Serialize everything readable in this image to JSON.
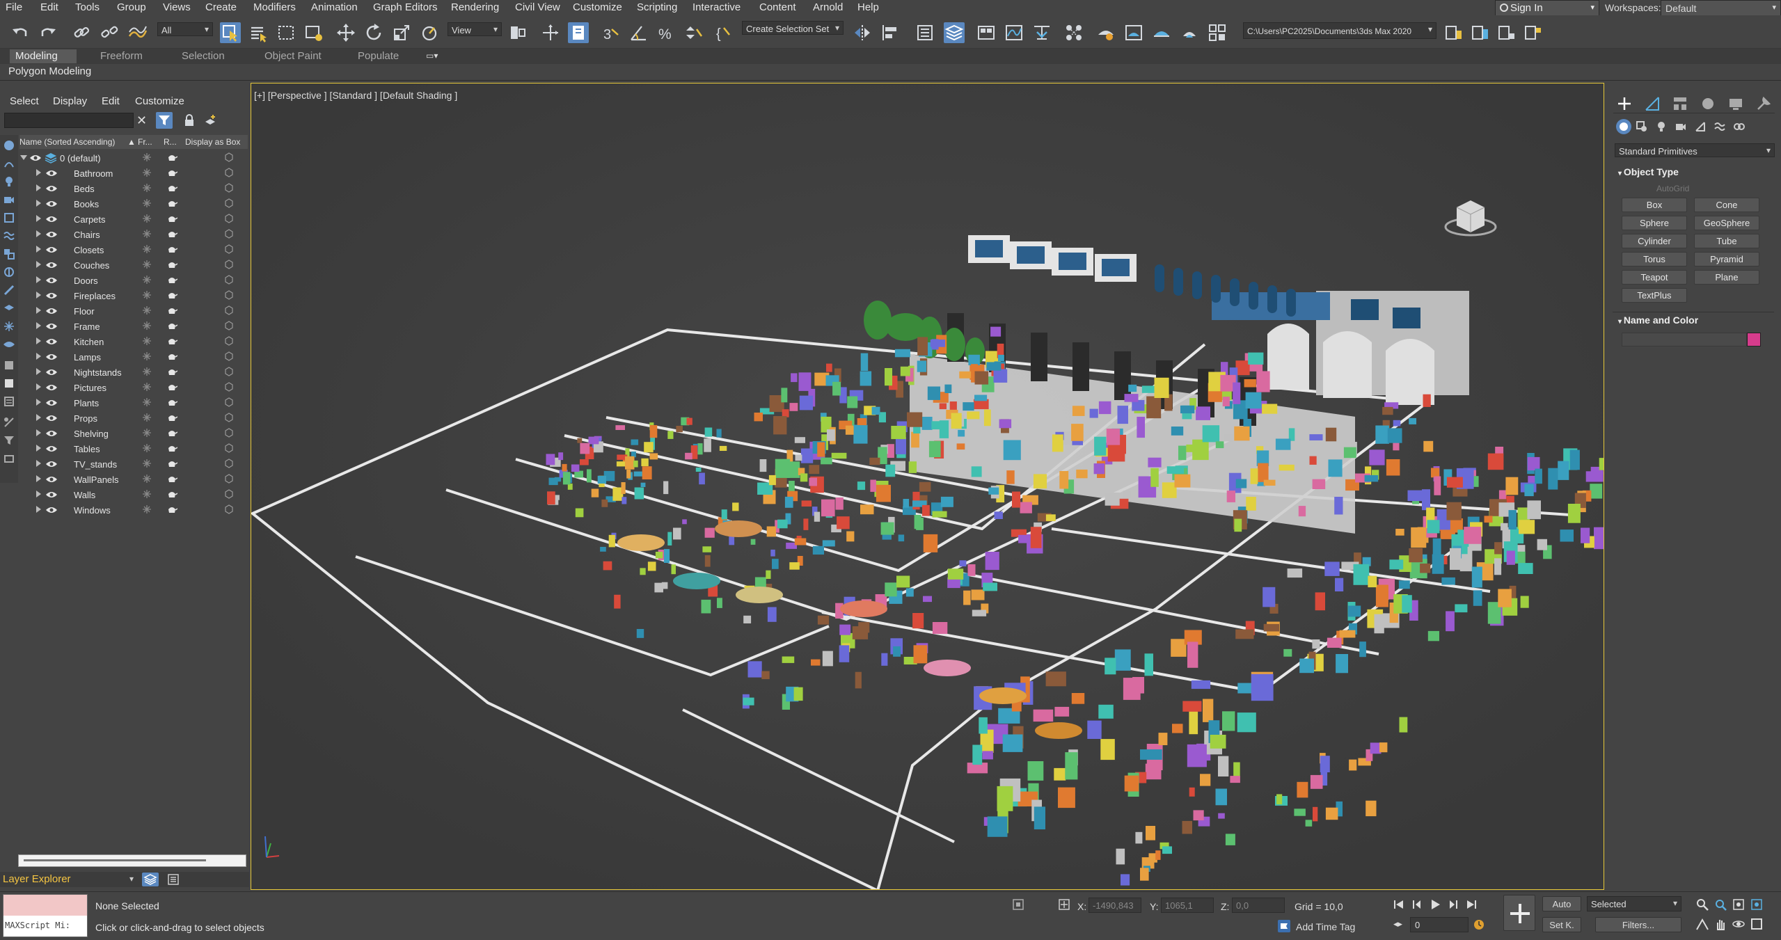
{
  "app": {
    "name": "3ds Max 2020"
  },
  "menubar": {
    "items": [
      "File",
      "Edit",
      "Tools",
      "Group",
      "Views",
      "Create",
      "Modifiers",
      "Animation",
      "Graph Editors",
      "Rendering",
      "Civil View",
      "Customize",
      "Scripting",
      "Interactive",
      "Content",
      "Arnold",
      "Help"
    ],
    "sign_in": "Sign In",
    "workspaces_label": "Workspaces:",
    "workspace_value": "Default"
  },
  "toolbar": {
    "selection_filter": "All",
    "reference_coord": "View",
    "named_selection": "Create Selection Set",
    "project_path": "C:\\Users\\PC2025\\Documents\\3ds Max 2020"
  },
  "ribbon": {
    "tabs": [
      "Modeling",
      "Freeform",
      "Selection",
      "Object Paint",
      "Populate"
    ],
    "active_tab": "Modeling",
    "subpanel": "Polygon Modeling"
  },
  "scene_explorer": {
    "menu": [
      "Select",
      "Display",
      "Edit",
      "Customize"
    ],
    "columns": {
      "name": "Name (Sorted Ascending)",
      "sort": "▲",
      "frozen": "Fr...",
      "renderable": "R...",
      "display_as_box": "Display as Box"
    },
    "root_layer": "0 (default)",
    "layers": [
      "Bathroom",
      "Beds",
      "Books",
      "Carpets",
      "Chairs",
      "Closets",
      "Couches",
      "Doors",
      "Fireplaces",
      "Floor",
      "Frame",
      "Kitchen",
      "Lamps",
      "Nightstands",
      "Pictures",
      "Plants",
      "Props",
      "Shelving",
      "Tables",
      "TV_stands",
      "WallPanels",
      "Walls",
      "Windows"
    ],
    "footer_label": "Layer Explorer"
  },
  "viewport": {
    "label": "[+] [Perspective ] [Standard ] [Default Shading ]"
  },
  "command_panel": {
    "category": "Standard Primitives",
    "object_type_title": "Object Type",
    "autogrid": "AutoGrid",
    "buttons": [
      "Box",
      "Cone",
      "Sphere",
      "GeoSphere",
      "Cylinder",
      "Tube",
      "Torus",
      "Pyramid",
      "Teapot",
      "Plane",
      "TextPlus"
    ],
    "name_color_title": "Name and Color",
    "object_color": "#d63c8c"
  },
  "status": {
    "maxscript_label": "MAXScript Mi:",
    "selection_status": "None Selected",
    "prompt": "Click or click-and-drag to select objects",
    "x_label": "X:",
    "x_value": "-1490,843",
    "y_label": "Y:",
    "y_value": "1065,1",
    "z_label": "Z:",
    "z_value": "0,0",
    "grid": "Grid = 10,0",
    "add_time_tag": "Add Time Tag",
    "auto_key": "Auto",
    "set_key": "Set K.",
    "key_filter": "Selected",
    "filters": "Filters...",
    "frame": "0"
  },
  "colors": {
    "accent": "#5a88c0",
    "viewport_border": "#e7c93a",
    "layer_explorer": "#f5c542"
  }
}
